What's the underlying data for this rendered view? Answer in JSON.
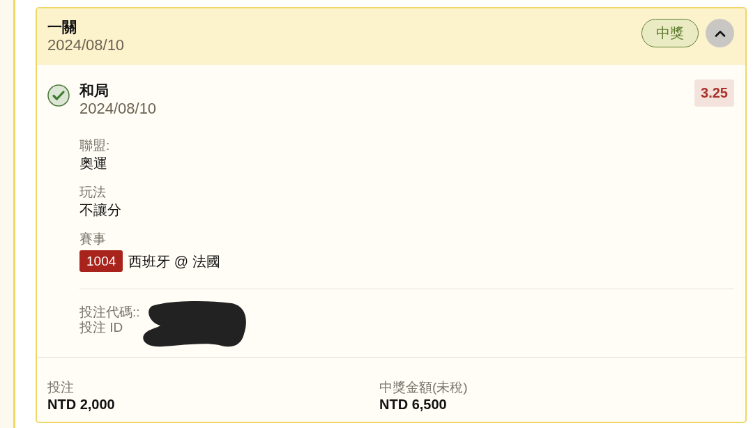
{
  "bet": {
    "title": "一關",
    "date": "2024/08/10",
    "status": "中獎",
    "expanded": true,
    "legs": [
      {
        "won": true,
        "pick": "和局",
        "date": "2024/08/10",
        "odds": "3.25",
        "fields": [
          {
            "label": "聯盟:",
            "value": "奧運"
          },
          {
            "label": "玩法",
            "value": "不讓分"
          },
          {
            "label": "賽事",
            "code": "1004",
            "value": "西班牙 @ 法國"
          }
        ],
        "refs": [
          "投注代碼::",
          "投注 ID"
        ],
        "redacted": true
      }
    ],
    "summary": [
      {
        "label": "投注",
        "value": "NTD 2,000"
      },
      {
        "label": "中獎金額(未稅)",
        "value": "NTD 6,500"
      }
    ]
  }
}
